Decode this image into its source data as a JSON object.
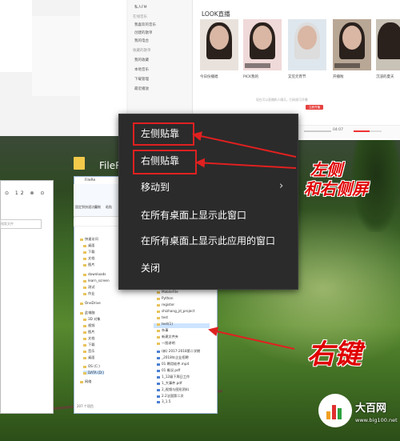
{
  "context_menu": {
    "items": [
      "左侧贴靠",
      "右侧贴靠",
      "移动到",
      "在所有桌面上显示此窗口",
      "在所有桌面上显示此应用的窗口",
      "关闭"
    ],
    "submenu_arrow": "›"
  },
  "annotations": {
    "left_right_line1": "左侧",
    "left_right_line2": "和右侧屏",
    "right_click": "右键",
    "color": "#e02020"
  },
  "desktop": {
    "window_label": "FileRe"
  },
  "browser": {
    "section_title": "LOOK直播",
    "sidebar_sections": [
      "在线音乐",
      "收藏的歌单"
    ],
    "sidebar_items": [
      "私人FM",
      "我喜欢的音乐",
      "创建的歌单",
      "我的电台",
      "我的收藏",
      "本地音乐",
      "下载管理",
      "最近播放"
    ],
    "live_captions": [
      "今日份播唱",
      "PICK我的",
      "又见元宵节",
      "开播啦",
      "沉浸的夏天"
    ],
    "notice": "现在可以直播和人聊天，扫码即可开播",
    "notice_button": "立即开播",
    "time": "04:07"
  },
  "explorer": {
    "title": "FileRe",
    "ribbon_labels": [
      "固定到快速访问",
      "复制",
      "粘贴"
    ],
    "tree": [
      "快速访问",
      "桌面",
      "下载",
      "文档",
      "图片",
      "downloads",
      "learn_screen",
      "测试",
      "作业",
      "OneDrive",
      "此电脑",
      "3D 对象",
      "视频",
      "图片",
      "文档",
      "下载",
      "音乐",
      "桌面",
      "OS (C:)",
      "DATA (D:)",
      "网络"
    ],
    "files": [
      "MobileFile",
      "Python",
      "register",
      "shizhang_jd_project",
      "test",
      "test(1)",
      "杂事",
      "新建文件夹",
      "一图讲明",
      "(新) 2017-2018第二学期",
      "_2018年企业招聘",
      "01 聘用软件.mp4",
      "01 概况.pdf",
      "1_12级下周日工作",
      "1_大事件.pdf",
      "2_视频与图形资料",
      "2.2法国第二次",
      "3_1.5"
    ],
    "status": "207 个项目"
  },
  "left_window": {
    "nums": "⊙ 12 ⊗ ⊙",
    "field": "搜索文件"
  },
  "watermark": {
    "name": "大百网",
    "url": "www.big100.net"
  }
}
